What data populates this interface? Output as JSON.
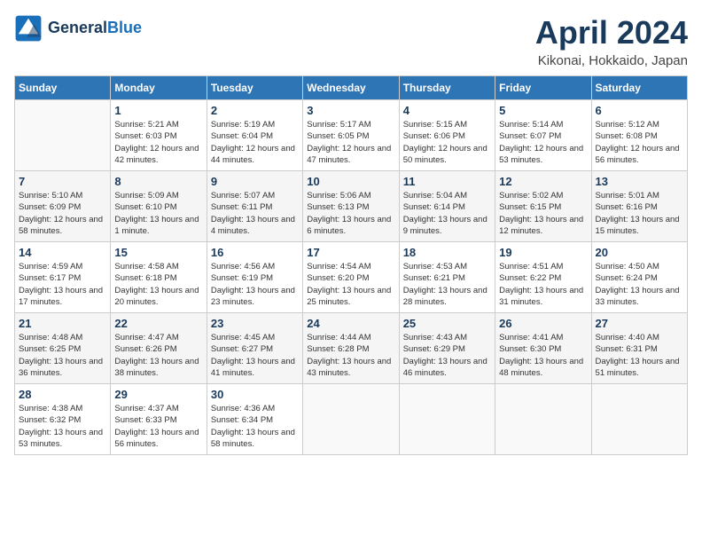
{
  "header": {
    "logo_line1": "General",
    "logo_line2": "Blue",
    "title": "April 2024",
    "location": "Kikonai, Hokkaido, Japan"
  },
  "days_of_week": [
    "Sunday",
    "Monday",
    "Tuesday",
    "Wednesday",
    "Thursday",
    "Friday",
    "Saturday"
  ],
  "weeks": [
    [
      null,
      {
        "day": "1",
        "sunrise": "Sunrise: 5:21 AM",
        "sunset": "Sunset: 6:03 PM",
        "daylight": "Daylight: 12 hours and 42 minutes."
      },
      {
        "day": "2",
        "sunrise": "Sunrise: 5:19 AM",
        "sunset": "Sunset: 6:04 PM",
        "daylight": "Daylight: 12 hours and 44 minutes."
      },
      {
        "day": "3",
        "sunrise": "Sunrise: 5:17 AM",
        "sunset": "Sunset: 6:05 PM",
        "daylight": "Daylight: 12 hours and 47 minutes."
      },
      {
        "day": "4",
        "sunrise": "Sunrise: 5:15 AM",
        "sunset": "Sunset: 6:06 PM",
        "daylight": "Daylight: 12 hours and 50 minutes."
      },
      {
        "day": "5",
        "sunrise": "Sunrise: 5:14 AM",
        "sunset": "Sunset: 6:07 PM",
        "daylight": "Daylight: 12 hours and 53 minutes."
      },
      {
        "day": "6",
        "sunrise": "Sunrise: 5:12 AM",
        "sunset": "Sunset: 6:08 PM",
        "daylight": "Daylight: 12 hours and 56 minutes."
      }
    ],
    [
      {
        "day": "7",
        "sunrise": "Sunrise: 5:10 AM",
        "sunset": "Sunset: 6:09 PM",
        "daylight": "Daylight: 12 hours and 58 minutes."
      },
      {
        "day": "8",
        "sunrise": "Sunrise: 5:09 AM",
        "sunset": "Sunset: 6:10 PM",
        "daylight": "Daylight: 13 hours and 1 minute."
      },
      {
        "day": "9",
        "sunrise": "Sunrise: 5:07 AM",
        "sunset": "Sunset: 6:11 PM",
        "daylight": "Daylight: 13 hours and 4 minutes."
      },
      {
        "day": "10",
        "sunrise": "Sunrise: 5:06 AM",
        "sunset": "Sunset: 6:13 PM",
        "daylight": "Daylight: 13 hours and 6 minutes."
      },
      {
        "day": "11",
        "sunrise": "Sunrise: 5:04 AM",
        "sunset": "Sunset: 6:14 PM",
        "daylight": "Daylight: 13 hours and 9 minutes."
      },
      {
        "day": "12",
        "sunrise": "Sunrise: 5:02 AM",
        "sunset": "Sunset: 6:15 PM",
        "daylight": "Daylight: 13 hours and 12 minutes."
      },
      {
        "day": "13",
        "sunrise": "Sunrise: 5:01 AM",
        "sunset": "Sunset: 6:16 PM",
        "daylight": "Daylight: 13 hours and 15 minutes."
      }
    ],
    [
      {
        "day": "14",
        "sunrise": "Sunrise: 4:59 AM",
        "sunset": "Sunset: 6:17 PM",
        "daylight": "Daylight: 13 hours and 17 minutes."
      },
      {
        "day": "15",
        "sunrise": "Sunrise: 4:58 AM",
        "sunset": "Sunset: 6:18 PM",
        "daylight": "Daylight: 13 hours and 20 minutes."
      },
      {
        "day": "16",
        "sunrise": "Sunrise: 4:56 AM",
        "sunset": "Sunset: 6:19 PM",
        "daylight": "Daylight: 13 hours and 23 minutes."
      },
      {
        "day": "17",
        "sunrise": "Sunrise: 4:54 AM",
        "sunset": "Sunset: 6:20 PM",
        "daylight": "Daylight: 13 hours and 25 minutes."
      },
      {
        "day": "18",
        "sunrise": "Sunrise: 4:53 AM",
        "sunset": "Sunset: 6:21 PM",
        "daylight": "Daylight: 13 hours and 28 minutes."
      },
      {
        "day": "19",
        "sunrise": "Sunrise: 4:51 AM",
        "sunset": "Sunset: 6:22 PM",
        "daylight": "Daylight: 13 hours and 31 minutes."
      },
      {
        "day": "20",
        "sunrise": "Sunrise: 4:50 AM",
        "sunset": "Sunset: 6:24 PM",
        "daylight": "Daylight: 13 hours and 33 minutes."
      }
    ],
    [
      {
        "day": "21",
        "sunrise": "Sunrise: 4:48 AM",
        "sunset": "Sunset: 6:25 PM",
        "daylight": "Daylight: 13 hours and 36 minutes."
      },
      {
        "day": "22",
        "sunrise": "Sunrise: 4:47 AM",
        "sunset": "Sunset: 6:26 PM",
        "daylight": "Daylight: 13 hours and 38 minutes."
      },
      {
        "day": "23",
        "sunrise": "Sunrise: 4:45 AM",
        "sunset": "Sunset: 6:27 PM",
        "daylight": "Daylight: 13 hours and 41 minutes."
      },
      {
        "day": "24",
        "sunrise": "Sunrise: 4:44 AM",
        "sunset": "Sunset: 6:28 PM",
        "daylight": "Daylight: 13 hours and 43 minutes."
      },
      {
        "day": "25",
        "sunrise": "Sunrise: 4:43 AM",
        "sunset": "Sunset: 6:29 PM",
        "daylight": "Daylight: 13 hours and 46 minutes."
      },
      {
        "day": "26",
        "sunrise": "Sunrise: 4:41 AM",
        "sunset": "Sunset: 6:30 PM",
        "daylight": "Daylight: 13 hours and 48 minutes."
      },
      {
        "day": "27",
        "sunrise": "Sunrise: 4:40 AM",
        "sunset": "Sunset: 6:31 PM",
        "daylight": "Daylight: 13 hours and 51 minutes."
      }
    ],
    [
      {
        "day": "28",
        "sunrise": "Sunrise: 4:38 AM",
        "sunset": "Sunset: 6:32 PM",
        "daylight": "Daylight: 13 hours and 53 minutes."
      },
      {
        "day": "29",
        "sunrise": "Sunrise: 4:37 AM",
        "sunset": "Sunset: 6:33 PM",
        "daylight": "Daylight: 13 hours and 56 minutes."
      },
      {
        "day": "30",
        "sunrise": "Sunrise: 4:36 AM",
        "sunset": "Sunset: 6:34 PM",
        "daylight": "Daylight: 13 hours and 58 minutes."
      },
      null,
      null,
      null,
      null
    ]
  ]
}
